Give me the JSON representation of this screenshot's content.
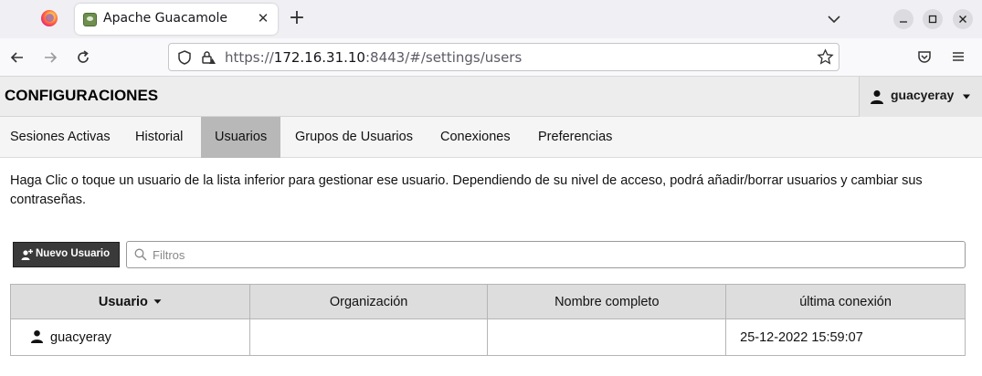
{
  "browser": {
    "tab_title": "Apache Guacamole",
    "url_scheme": "https://",
    "url_host": "172.16.31.10",
    "url_rest": ":8443/#/settings/users"
  },
  "header": {
    "title": "CONFIGURACIONES",
    "username": "guacyeray"
  },
  "settings_tabs": [
    {
      "label": "Sesiones Activas",
      "active": false
    },
    {
      "label": "Historial",
      "active": false
    },
    {
      "label": "Usuarios",
      "active": true
    },
    {
      "label": "Grupos de Usuarios",
      "active": false
    },
    {
      "label": "Conexiones",
      "active": false
    },
    {
      "label": "Preferencias",
      "active": false
    }
  ],
  "help_text": "Haga Clic o toque un usuario de la lista inferior para gestionar ese usuario. Dependiendo de su nivel de acceso, podrá añadir/borrar usuarios y cambiar sus contraseñas.",
  "toolbar": {
    "new_user_label": "Nuevo Usuario",
    "filter_placeholder": "Filtros"
  },
  "table": {
    "columns": [
      "Usuario",
      "Organización",
      "Nombre completo",
      "última conexión"
    ],
    "rows": [
      {
        "username": "guacyeray",
        "organization": "",
        "full_name": "",
        "last_active": "25-12-2022 15:59:07"
      }
    ]
  },
  "colors": {
    "active_tab": "#b8b8b8",
    "header_bg": "#ededed",
    "button_bg": "#3a3a3a",
    "table_header_bg": "#dddddd"
  }
}
